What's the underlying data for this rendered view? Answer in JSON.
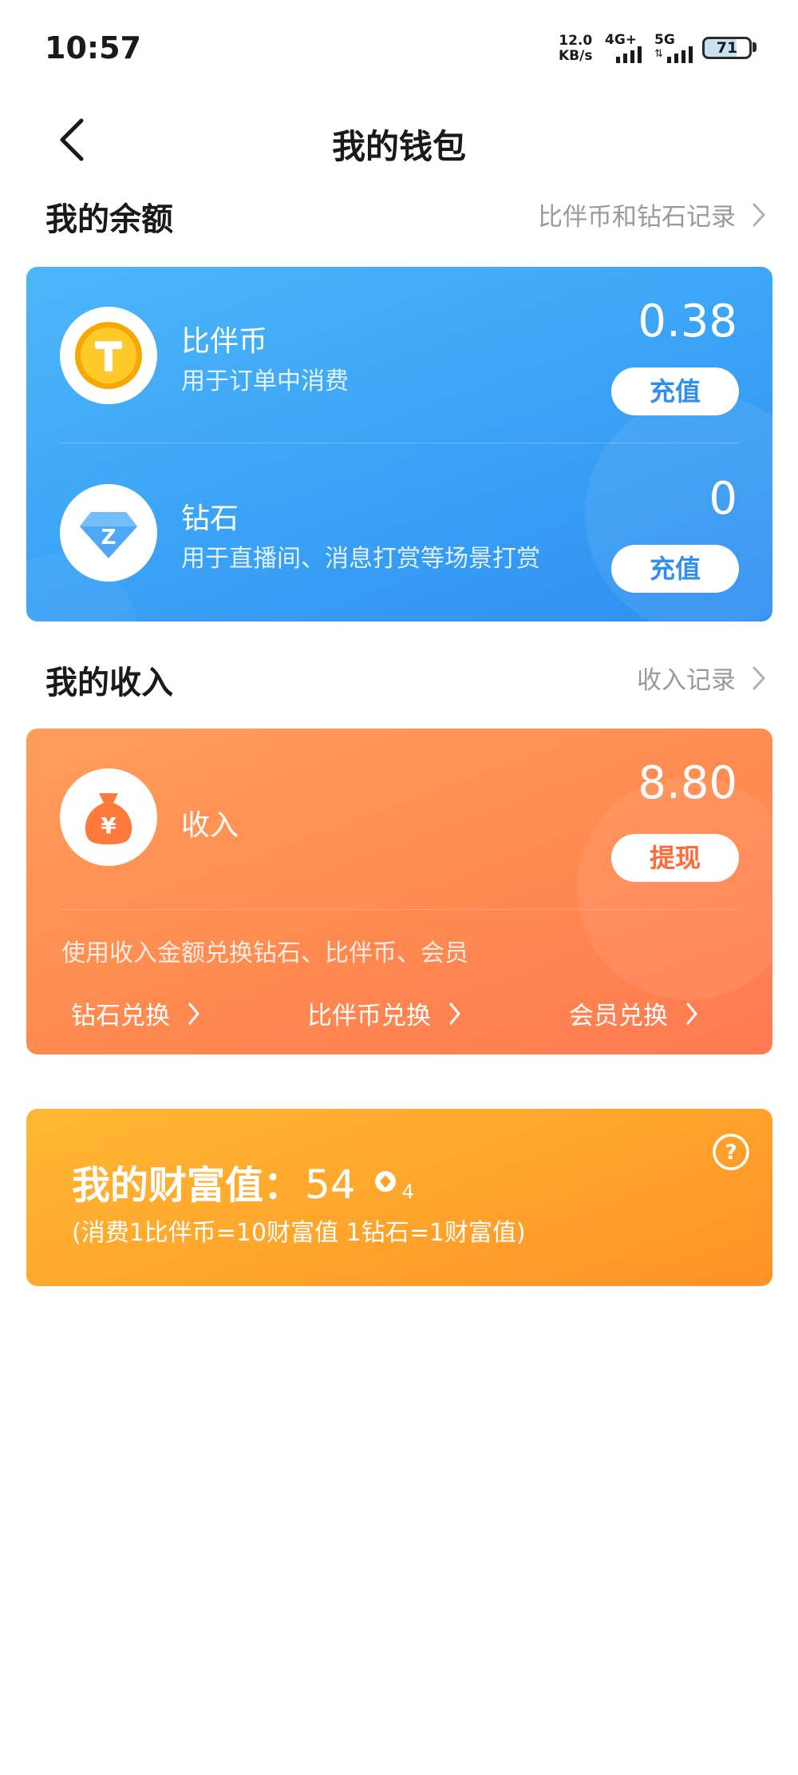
{
  "status_bar": {
    "time": "10:57",
    "net_speed_value": "12.0",
    "net_speed_unit": "KB/s",
    "signal1_label": "4G+",
    "signal2_label": "5G",
    "battery": "71"
  },
  "nav": {
    "title": "我的钱包"
  },
  "balance_section": {
    "title": "我的余额",
    "link": "比伴币和钻石记录",
    "items": [
      {
        "name": "比伴币",
        "desc": "用于订单中消费",
        "amount": "0.38",
        "button": "充值",
        "icon": "coin-icon"
      },
      {
        "name": "钻石",
        "desc": "用于直播间、消息打赏等场景打赏",
        "amount": "0",
        "button": "充值",
        "icon": "diamond-icon"
      }
    ]
  },
  "income_section": {
    "title": "我的收入",
    "link": "收入记录",
    "name": "收入",
    "amount": "8.80",
    "button": "提现",
    "desc": "使用收入金额兑换钻石、比伴币、会员",
    "exchanges": [
      "钻石兑换",
      "比伴币兑换",
      "会员兑换"
    ],
    "icon": "money-bag-icon"
  },
  "wealth": {
    "title": "我的财富值：",
    "value": "54",
    "level": "4",
    "note": "(消费1比伴币=10财富值 1钻石=1财富值)",
    "help_icon": "help-icon"
  },
  "colors": {
    "blue_card": "#3aa2f6",
    "orange_card": "#ff8a50",
    "gold_card": "#ffa42b",
    "coin": "#f5b800",
    "diamond": "#4fa8f5"
  }
}
